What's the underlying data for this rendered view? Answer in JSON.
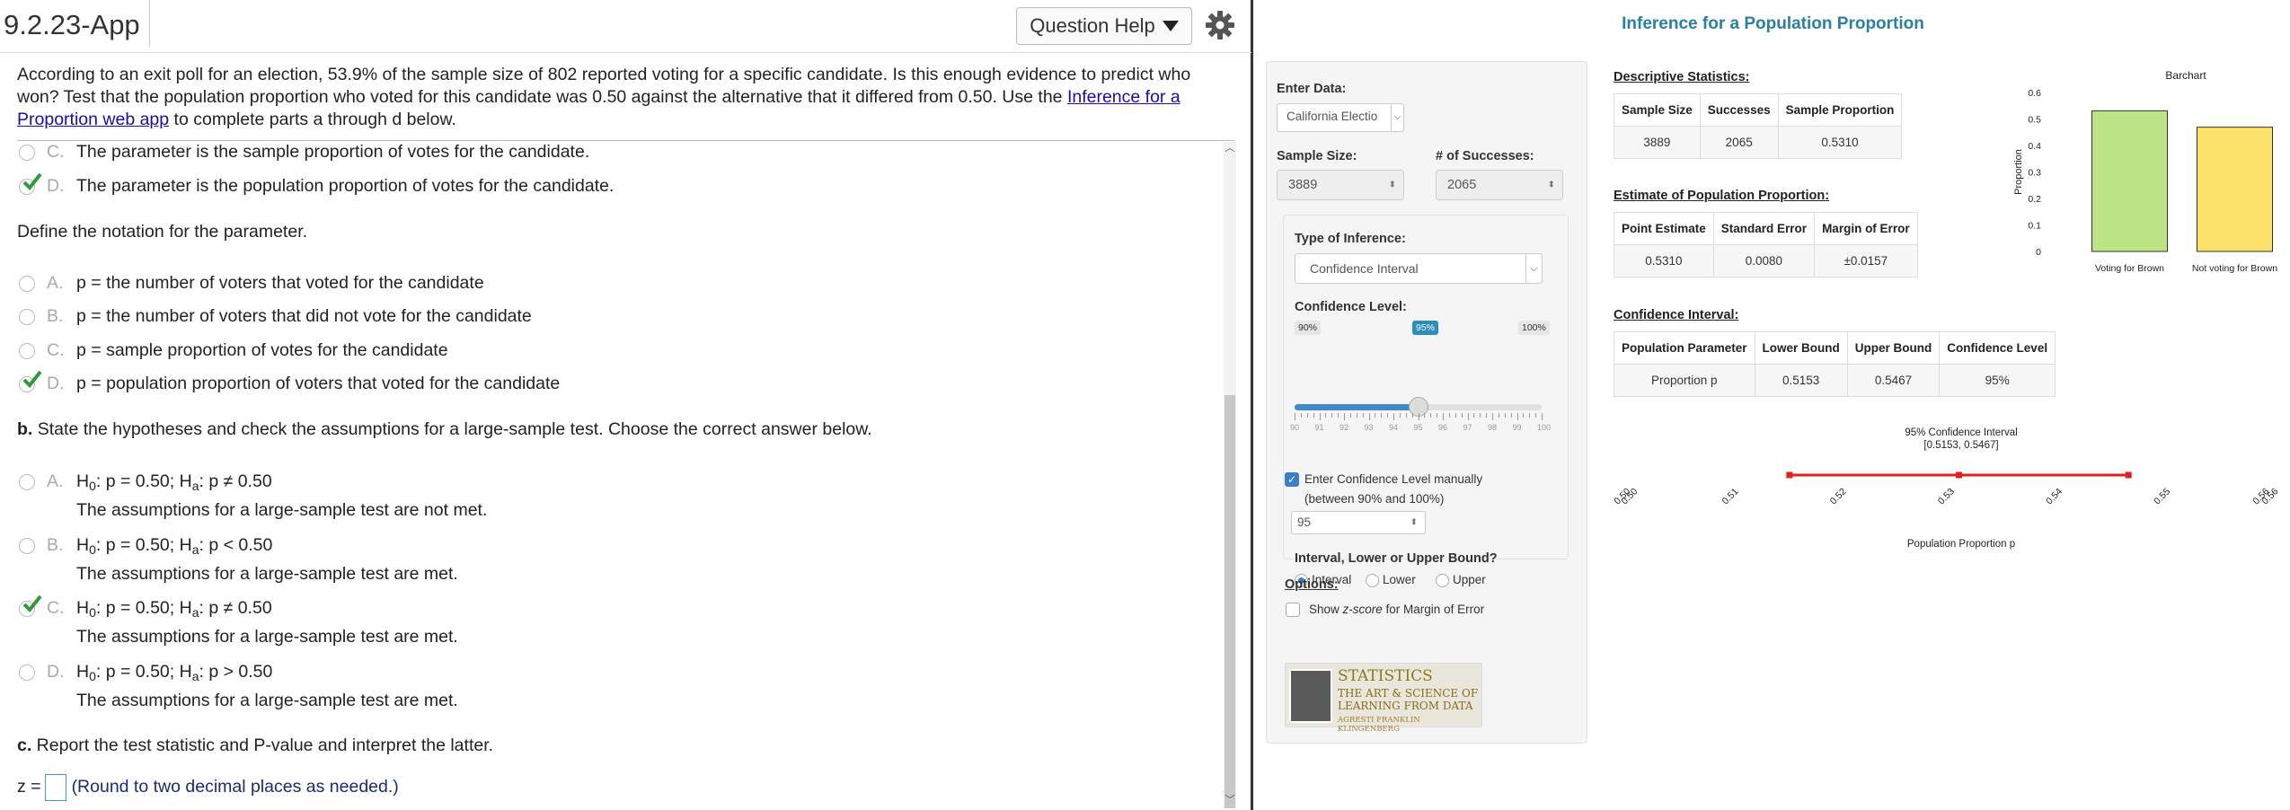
{
  "header": {
    "app_title": "9.2.23-App",
    "help_label": "Question Help"
  },
  "question": {
    "text_before": "According to an exit poll for an election, 53.9% of the sample size of 802 reported voting for a specific candidate. Is this enough evidence to predict who won? Test that the population proportion who voted for this candidate was 0.50 against the alternative that it differed from 0.50. Use the ",
    "link": "Inference for a Proportion web app",
    "text_after": " to complete parts a through d below."
  },
  "parameter_options": [
    {
      "letter": "C.",
      "text": "The parameter is the sample proportion of votes for the candidate.",
      "checked": false
    },
    {
      "letter": "D.",
      "text": "The parameter is the population proportion of votes for the candidate.",
      "checked": true
    }
  ],
  "notation_prompt": "Define the notation for the parameter.",
  "notation_options": [
    {
      "letter": "A.",
      "text": "p = the number of voters that voted for the candidate",
      "checked": false
    },
    {
      "letter": "B.",
      "text": "p = the number of voters that did not vote for the candidate",
      "checked": false
    },
    {
      "letter": "C.",
      "text": "p = sample proportion of votes for the candidate",
      "checked": false
    },
    {
      "letter": "D.",
      "text": "p = population proportion of voters that voted for the candidate",
      "checked": true
    }
  ],
  "part_b": {
    "label": "b.",
    "prompt": " State the hypotheses and check the assumptions for a large-sample test. Choose the correct answer below."
  },
  "hypothesis_options": [
    {
      "letter": "A.",
      "h0": "p = 0.50; H",
      "ha": "p ≠ 0.50",
      "note": "The assumptions for a large-sample test are not met.",
      "checked": false
    },
    {
      "letter": "B.",
      "h0": "p = 0.50; H",
      "ha": "p < 0.50",
      "note": "The assumptions for a large-sample test are met.",
      "checked": false
    },
    {
      "letter": "C.",
      "h0": "p = 0.50; H",
      "ha": "p ≠ 0.50",
      "note": "The assumptions for a large-sample test are met.",
      "checked": true
    },
    {
      "letter": "D.",
      "h0": "p = 0.50; H",
      "ha": "p > 0.50",
      "note": "The assumptions for a large-sample test are met.",
      "checked": false
    }
  ],
  "part_c": {
    "label": "c.",
    "prompt": " Report the test statistic and P-value and interpret the latter.",
    "z_label": "z =",
    "round_note": "(Round to two decimal places as needed.)"
  },
  "app": {
    "title": "Inference for a Population Proportion",
    "enter_data_label": "Enter Data:",
    "dataset": "California Electio",
    "sample_size_label": "Sample Size:",
    "sample_size": "3889",
    "successes_label": "# of Successes:",
    "successes": "2065",
    "type_label": "Type of Inference:",
    "type_value": "Confidence Interval",
    "conf_label": "Confidence Level:",
    "slider_min": "90%",
    "slider_max": "100%",
    "slider_value_label": "95%",
    "slider_value": 95,
    "slider_ticks": [
      "90",
      "91",
      "92",
      "93",
      "94",
      "95",
      "96",
      "97",
      "98",
      "99",
      "100"
    ],
    "manual_label": "Enter Confidence Level manually",
    "manual_sub": "(between 90% and 100%)",
    "manual_value": "95",
    "bound_label": "Interval, Lower or Upper Bound?",
    "bound_options": [
      "Interval",
      "Lower",
      "Upper"
    ],
    "options_label": "Options:",
    "zscore_pre": "Show ",
    "zscore_em": "z-score",
    "zscore_post": " for Margin of Error",
    "book_title": "STATISTICS",
    "book_sub1": "THE ART & SCIENCE OF",
    "book_sub2": "LEARNING FROM DATA",
    "book_authors": "AGRESTI   FRANKLIN   KLINGENBERG"
  },
  "desc_stats": {
    "heading": "Descriptive Statistics:",
    "headers": [
      "Sample Size",
      "Successes",
      "Sample Proportion"
    ],
    "row": [
      "3889",
      "2065",
      "0.5310"
    ]
  },
  "estimate": {
    "heading": "Estimate of Population Proportion:",
    "headers": [
      "Point Estimate",
      "Standard Error",
      "Margin of Error"
    ],
    "row": [
      "0.5310",
      "0.0080",
      "±0.0157"
    ]
  },
  "ci_table": {
    "heading": "Confidence Interval:",
    "headers": [
      "Population Parameter",
      "Lower Bound",
      "Upper Bound",
      "Confidence Level"
    ],
    "row": [
      "Proportion p",
      "0.5153",
      "0.5467",
      "95%"
    ]
  },
  "colors": {
    "bar1": "#bde387",
    "bar2": "#fde26a",
    "ci_line": "#e32020",
    "accent": "#2a7fa6"
  },
  "chart_data": [
    {
      "type": "bar",
      "title": "Barchart",
      "ylabel": "Proportion",
      "categories": [
        "Voting for Brown",
        "Not voting for Brown"
      ],
      "values": [
        0.531,
        0.469
      ],
      "ylim": [
        0,
        0.6
      ],
      "yticks": [
        "0",
        "0.1",
        "0.2",
        "0.3",
        "0.4",
        "0.5",
        "0.6"
      ]
    },
    {
      "type": "line",
      "title": "95% Confidence Interval",
      "subtitle": "[0.5153, 0.5467]",
      "xlabel": "Population Proportion p",
      "lower": 0.5153,
      "estimate": 0.531,
      "upper": 0.5467,
      "xlim": [
        0.5,
        0.56
      ],
      "xticks": [
        "0.50",
        "0.50",
        "0.51",
        "0.52",
        "0.53",
        "0.54",
        "0.55",
        "0.56",
        "0.56"
      ],
      "xtick_values": [
        0.5,
        0.5,
        0.51,
        0.52,
        0.53,
        0.54,
        0.55,
        0.56,
        0.56
      ]
    }
  ]
}
